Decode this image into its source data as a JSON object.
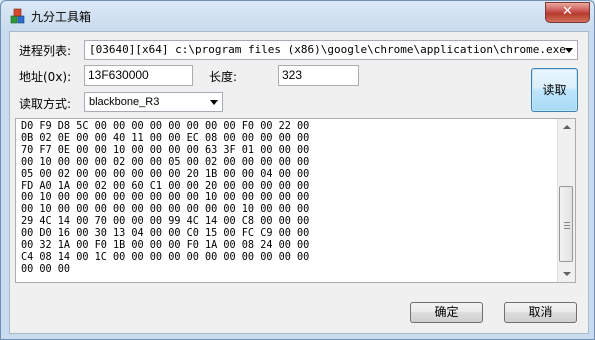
{
  "window": {
    "title": "九分工具箱",
    "close_glyph": "✕",
    "icon": "app-icon"
  },
  "process": {
    "label": "进程列表:",
    "selected": "[03640][x64] c:\\program files (x86)\\google\\chrome\\application\\chrome.exe"
  },
  "address": {
    "label": "地址(0x):",
    "value": "13F630000"
  },
  "length": {
    "label": "长度:",
    "value": "323"
  },
  "read_button": {
    "label": "读取"
  },
  "read_mode": {
    "label": "读取方式:",
    "selected": "blackbone_R3"
  },
  "output": {
    "text": "D0 F9 D8 5C 00 00 00 00 00 00 00 00 F0 00 22 00\n0B 02 0E 00 00 40 11 00 00 EC 08 00 00 00 00 00\n70 F7 0E 00 00 10 00 00 00 00 63 3F 01 00 00 00\n00 10 00 00 00 02 00 00 05 00 02 00 00 00 00 00\n05 00 02 00 00 00 00 00 00 20 1B 00 00 04 00 00\nFD A0 1A 00 02 00 60 C1 00 00 20 00 00 00 00 00\n00 10 00 00 00 00 00 00 00 00 10 00 00 00 00 00\n00 10 00 00 00 00 00 00 00 00 00 00 10 00 00 00\n29 4C 14 00 70 00 00 00 99 4C 14 00 C8 00 00 00\n00 D0 16 00 30 13 04 00 00 C0 15 00 FC C9 00 00\n00 32 1A 00 F0 1B 00 00 00 F0 1A 00 08 24 00 00\nC4 08 14 00 1C 00 00 00 00 00 00 00 00 00 00 00\n00 00 00"
  },
  "footer": {
    "ok_label": "确定",
    "cancel_label": "取消"
  }
}
